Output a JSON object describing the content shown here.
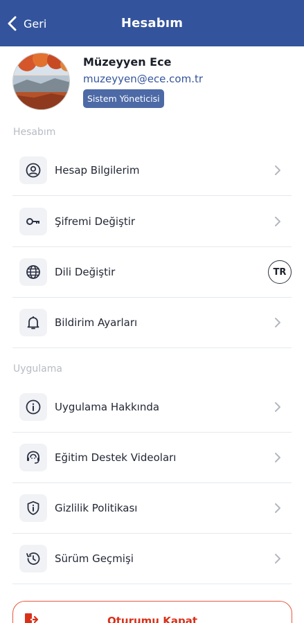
{
  "header": {
    "back_label": "Geri",
    "title": "Hesabım",
    "color": "#33549c"
  },
  "profile": {
    "name": "Müzeyyen Ece",
    "email": "muzeyyen@ece.com.tr",
    "role": "Sistem Yöneticisi"
  },
  "sections": {
    "account": {
      "label": "Hesabım",
      "items": [
        {
          "label": "Hesap Bilgilerim",
          "icon": "user-circle-icon"
        },
        {
          "label": "Şifremi Değiştir",
          "icon": "key-icon"
        },
        {
          "label": "Dili Değiştir",
          "icon": "globe-icon",
          "badge": "TR"
        },
        {
          "label": "Bildirim Ayarları",
          "icon": "bell-icon"
        }
      ]
    },
    "app": {
      "label": "Uygulama",
      "items": [
        {
          "label": "Uygulama Hakkında",
          "icon": "info-icon"
        },
        {
          "label": "Eğitim Destek Videoları",
          "icon": "support-agent-icon"
        },
        {
          "label": "Gizlilik Politikası",
          "icon": "shield-info-icon"
        },
        {
          "label": "Sürüm Geçmişi",
          "icon": "history-icon"
        }
      ]
    }
  },
  "logout": {
    "label": "Oturumu Kapat",
    "color": "#d9301a"
  }
}
